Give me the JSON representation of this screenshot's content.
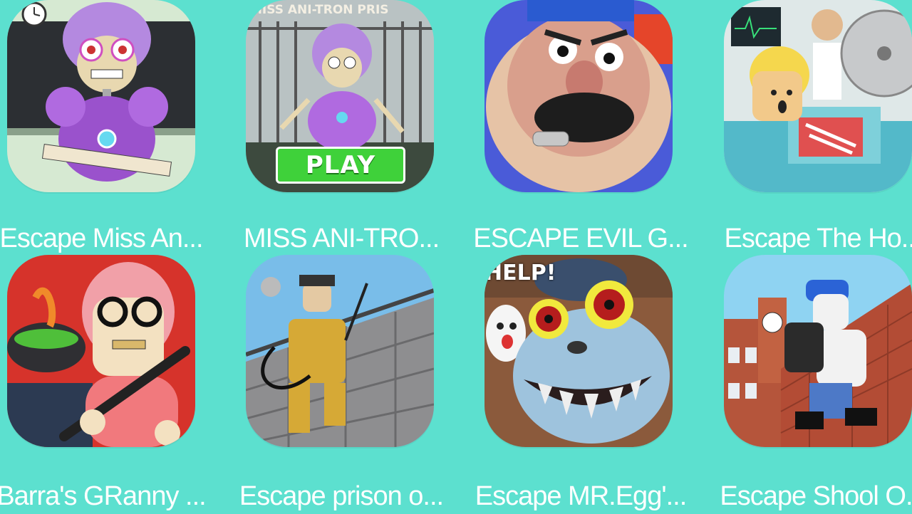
{
  "page": {
    "background": "#5ce0cf"
  },
  "apps": [
    {
      "title": "Escape Miss An...",
      "icon": "teacher-robot-icon"
    },
    {
      "title": "MISS ANI-TRO...",
      "icon": "robot-prison-icon",
      "banner": "MISS ANI-TRON PRIS",
      "button": "PLAY"
    },
    {
      "title": "ESCAPE EVIL G...",
      "icon": "angry-coach-icon"
    },
    {
      "title": "Escape The Ho...",
      "icon": "hospital-saw-icon"
    },
    {
      "title": "Barra's GRanny ...",
      "icon": "granny-bat-icon"
    },
    {
      "title": "Escape prison o...",
      "icon": "prison-climber-icon"
    },
    {
      "title": "Escape MR.Egg'...",
      "icon": "mr-egg-monster-icon",
      "banner": "HELP!"
    },
    {
      "title": "Escape Shool O...",
      "icon": "school-climber-icon"
    }
  ]
}
